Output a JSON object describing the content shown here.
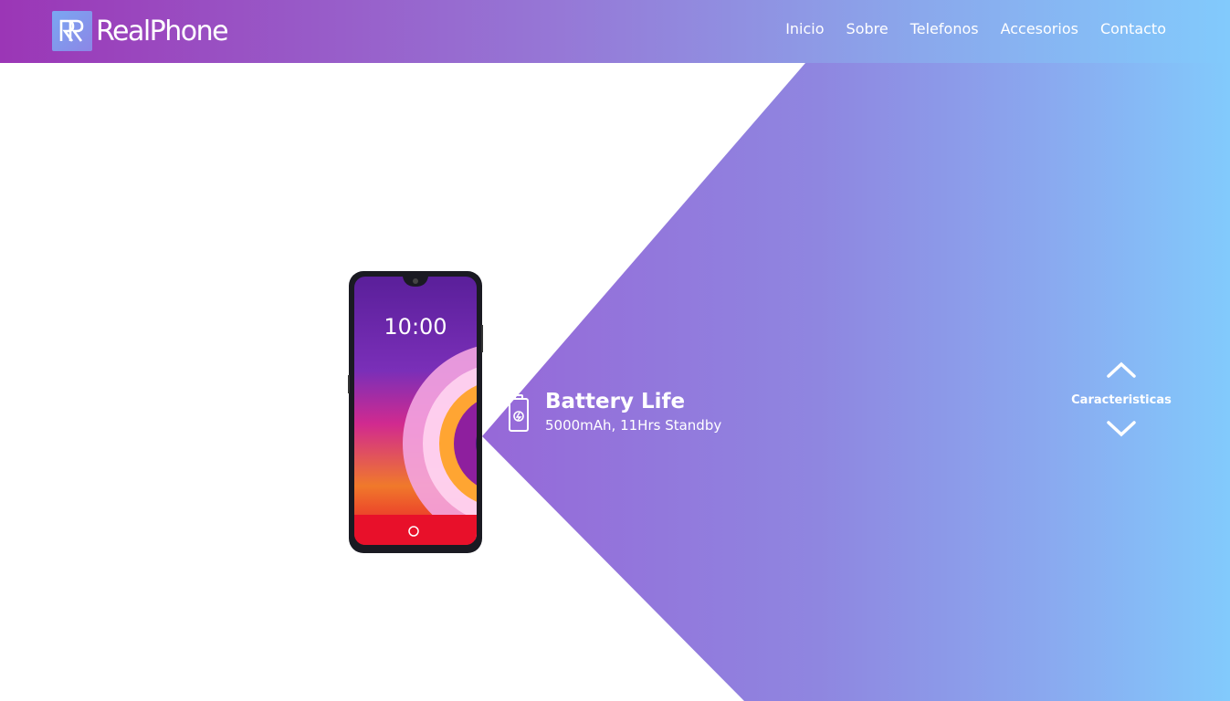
{
  "brand": {
    "name": "RealPhone",
    "logo_icon": "rp-monogram-icon",
    "colors": {
      "gradient_start": "#9b36b6",
      "gradient_mid": "#9677d6",
      "gradient_end": "#82cafc",
      "text": "#ffffff"
    }
  },
  "nav": {
    "items": [
      {
        "label": "Inicio"
      },
      {
        "label": "Sobre"
      },
      {
        "label": "Telefonos"
      },
      {
        "label": "Accesorios"
      },
      {
        "label": "Contacto"
      }
    ]
  },
  "phone": {
    "time": "10:00"
  },
  "feature": {
    "icon": "battery-icon",
    "title": "Battery Life",
    "subtitle": "5000mAh, 11Hrs Standby"
  },
  "side_nav": {
    "label": "Caracteristicas",
    "up_icon": "chevron-up-icon",
    "down_icon": "chevron-down-icon"
  }
}
